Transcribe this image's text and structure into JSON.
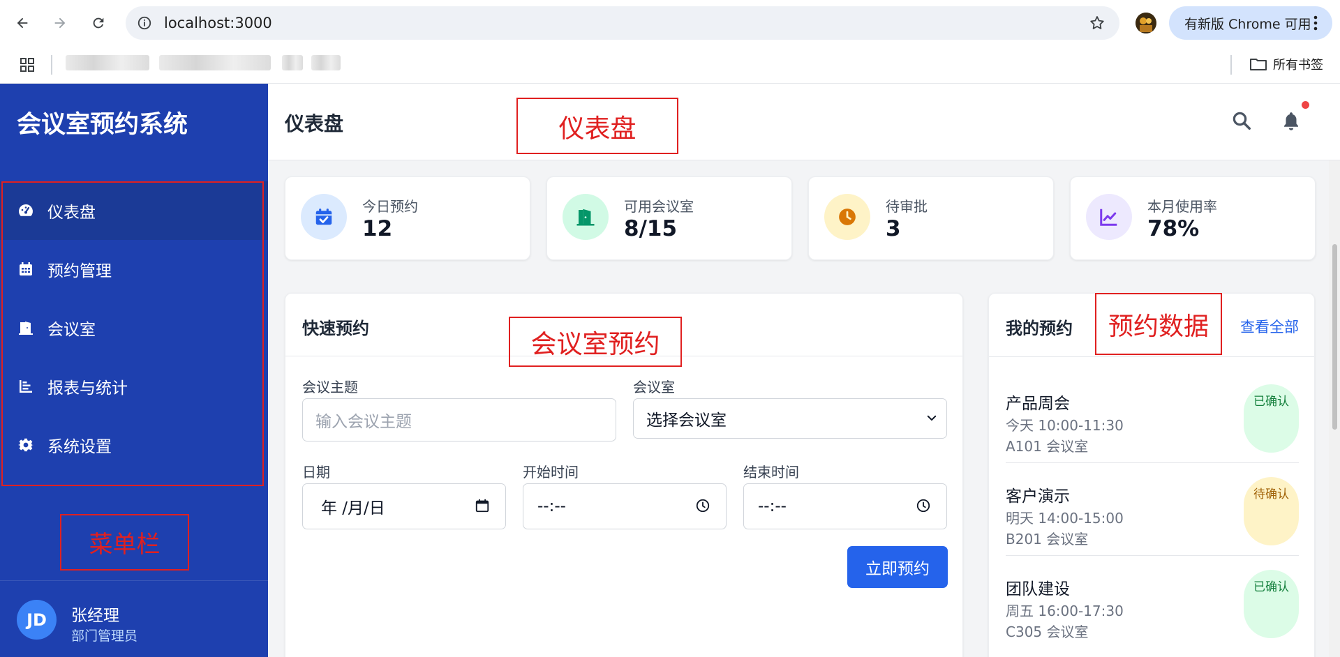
{
  "browser": {
    "url": "localhost:3000",
    "update_label": "有新版 Chrome 可用",
    "all_bookmarks": "所有书签"
  },
  "app": {
    "brand": "会议室预约系统",
    "page_title": "仪表盘",
    "sidebar": {
      "items": [
        {
          "label": "仪表盘",
          "icon": "dashboard-icon"
        },
        {
          "label": "预约管理",
          "icon": "calendar-icon"
        },
        {
          "label": "会议室",
          "icon": "door-icon"
        },
        {
          "label": "报表与统计",
          "icon": "bar-chart-icon"
        },
        {
          "label": "系统设置",
          "icon": "gear-icon"
        }
      ]
    },
    "user": {
      "initials": "JD",
      "name": "张经理",
      "role": "部门管理员"
    },
    "stats": [
      {
        "label": "今日预约",
        "value": "12",
        "icon": "calendar-check-icon",
        "color": "#2563eb",
        "bg": "#dbeafe"
      },
      {
        "label": "可用会议室",
        "value": "8/15",
        "icon": "door-open-icon",
        "color": "#059669",
        "bg": "#d1fae5"
      },
      {
        "label": "待审批",
        "value": "3",
        "icon": "clock-icon",
        "color": "#d97706",
        "bg": "#fef3c7"
      },
      {
        "label": "本月使用率",
        "value": "78%",
        "icon": "line-chart-icon",
        "color": "#7c3aed",
        "bg": "#ede9fe"
      }
    ],
    "quick_booking": {
      "title": "快速预约",
      "topic_label": "会议主题",
      "topic_placeholder": "输入会议主题",
      "room_label": "会议室",
      "room_value": "选择会议室",
      "date_label": "日期",
      "date_value": "年 /月/日",
      "start_label": "开始时间",
      "start_value": "--:--",
      "end_label": "结束时间",
      "end_value": "--:--",
      "submit": "立即预约"
    },
    "my_bookings": {
      "title": "我的预约",
      "view_all": "查看全部",
      "items": [
        {
          "title": "产品周会",
          "time": "今天 10:00-11:30",
          "room": "A101 会议室",
          "status": "已确认",
          "status_color": "#15803d",
          "status_bg": "#dcfce7"
        },
        {
          "title": "客户演示",
          "time": "明天 14:00-15:00",
          "room": "B201 会议室",
          "status": "待确认",
          "status_color": "#a16207",
          "status_bg": "#fef3c7"
        },
        {
          "title": "团队建设",
          "time": "周五 16:00-17:30",
          "room": "C305 会议室",
          "status": "已确认",
          "status_color": "#15803d",
          "status_bg": "#dcfce7"
        }
      ]
    }
  },
  "annotations": {
    "dashboard": "仪表盘",
    "booking": "会议室预约",
    "data": "预约数据",
    "menu": "菜单栏"
  }
}
